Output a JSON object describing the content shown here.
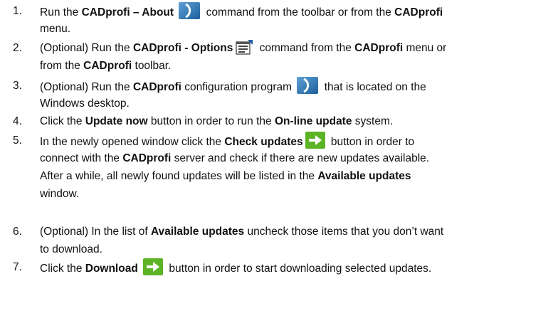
{
  "steps": [
    {
      "num": "1.",
      "lines": [
        [
          {
            "t": "Run the "
          },
          {
            "t": "CADprofi – About",
            "b": true
          },
          {
            "t": " "
          },
          {
            "icon": "cadprofi-about-icon"
          },
          {
            "t": " command from the toolbar or from the "
          },
          {
            "t": "CADprofi",
            "b": true
          }
        ],
        [
          {
            "t": "menu."
          }
        ]
      ]
    },
    {
      "num": "2.",
      "lines": [
        [
          {
            "t": "(Optional) Run the "
          },
          {
            "t": "CADprofi - Options",
            "b": true
          },
          {
            "icon": "cadprofi-options-icon"
          },
          {
            "t": " command from the "
          },
          {
            "t": "CADprofi",
            "b": true
          },
          {
            "t": " menu or"
          }
        ],
        [
          {
            "t": "from the "
          },
          {
            "t": "CADprofi",
            "b": true
          },
          {
            "t": " toolbar."
          }
        ]
      ]
    },
    {
      "num": "3.",
      "lines": [
        [
          {
            "t": "(Optional) Run the "
          },
          {
            "t": "CADprofi",
            "b": true
          },
          {
            "t": " configuration program "
          },
          {
            "icon": "cadprofi-config-icon"
          },
          {
            "t": " that is located on the"
          }
        ],
        [
          {
            "t": "Windows desktop."
          }
        ]
      ]
    },
    {
      "num": "4.",
      "lines": [
        [
          {
            "t": "Click the "
          },
          {
            "t": "Update now",
            "b": true
          },
          {
            "t": " button in order to run the "
          },
          {
            "t": "On-line update",
            "b": true
          },
          {
            "t": " system."
          }
        ]
      ]
    },
    {
      "num": "5.",
      "lines": [
        [
          {
            "t": "In the newly opened window click the "
          },
          {
            "t": "Check updates",
            "b": true
          },
          {
            "icon": "check-updates-arrow-icon"
          },
          {
            "t": " button in order to"
          }
        ],
        [
          {
            "t": "connect with the "
          },
          {
            "t": "CADprofi",
            "b": true
          },
          {
            "t": " server and check if there are new updates available."
          }
        ],
        [
          {
            "t": "After a while, all newly found updates will be listed in the "
          },
          {
            "t": "Available updates",
            "b": true
          }
        ],
        [
          {
            "t": "window."
          }
        ]
      ]
    },
    {
      "num": "6.",
      "lines": [
        [
          {
            "t": "(Optional) In the list of "
          },
          {
            "t": "Available updates",
            "b": true
          },
          {
            "t": " uncheck those items that you don’t want"
          }
        ],
        [
          {
            "t": "to download."
          }
        ]
      ]
    },
    {
      "num": "7.",
      "lines": [
        [
          {
            "t": "Click the "
          },
          {
            "t": "Download",
            "b": true
          },
          {
            "t": " "
          },
          {
            "icon": "download-arrow-icon"
          },
          {
            "t": " button in order to start downloading selected updates."
          }
        ]
      ]
    }
  ]
}
